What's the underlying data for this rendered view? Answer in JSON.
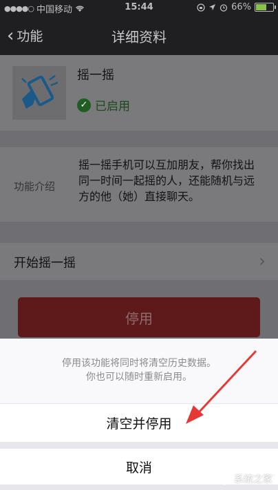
{
  "status_bar": {
    "signal_dots": "●●●●○",
    "carrier": "中国移动",
    "time": "15:44",
    "battery": "66%",
    "battery_level": 0.66,
    "battery_color": "#8bc34a"
  },
  "nav": {
    "back_label": "功能",
    "title": "详细资料"
  },
  "feature": {
    "name": "摇一摇",
    "status": "已启用",
    "icon": "phone-shake-icon",
    "accent": "#1e88e5"
  },
  "intro": {
    "label": "功能介绍",
    "description": "摇一摇手机可以互加朋友，帮你找出同一时间一起摇的人，还能随机与远方的他（她）直接聊天。"
  },
  "start_row": {
    "label": "开始摇一摇"
  },
  "disable_button": {
    "label": "停用",
    "color": "#e05252"
  },
  "action_sheet": {
    "message_line1": "停用该功能将同时将清空历史数据。",
    "message_line2": "你也可以随时重新启用。",
    "confirm_label": "清空并停用",
    "cancel_label": "取消"
  },
  "watermark": {
    "text": "系统之家"
  }
}
